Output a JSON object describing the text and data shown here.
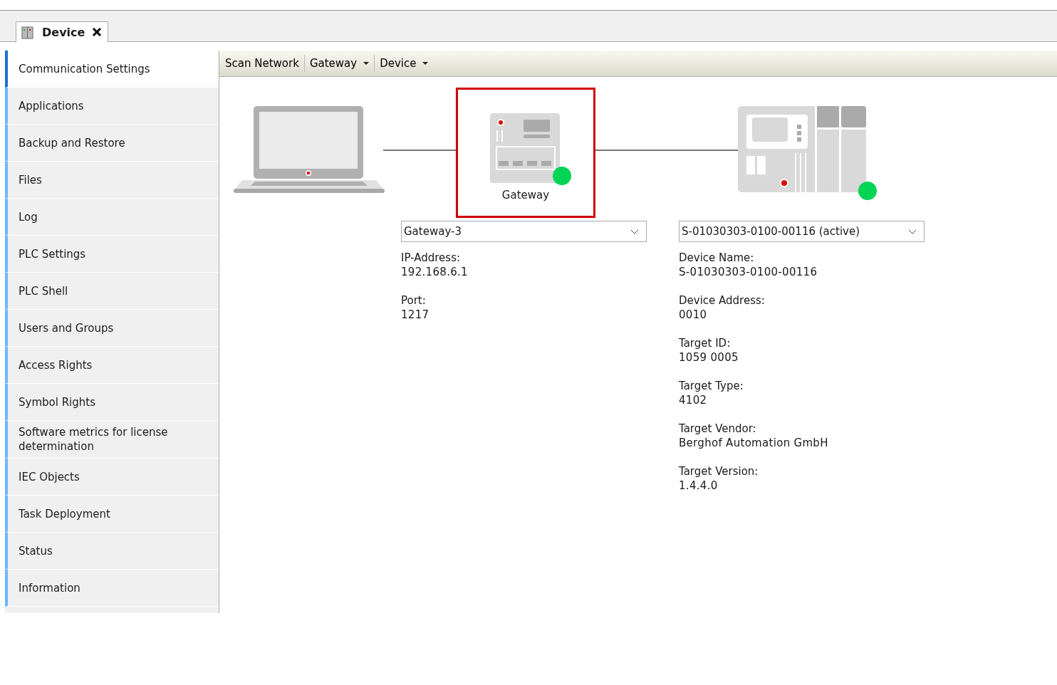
{
  "editor_tab": {
    "title": "Device",
    "selected": true
  },
  "sidebar": {
    "items": [
      {
        "label": "Communication Settings",
        "selected": true
      },
      {
        "label": "Applications",
        "selected": false
      },
      {
        "label": "Backup and Restore",
        "selected": false
      },
      {
        "label": "Files",
        "selected": false
      },
      {
        "label": "Log",
        "selected": false
      },
      {
        "label": "PLC Settings",
        "selected": false
      },
      {
        "label": "PLC Shell",
        "selected": false
      },
      {
        "label": "Users and Groups",
        "selected": false
      },
      {
        "label": "Access Rights",
        "selected": false
      },
      {
        "label": "Symbol Rights",
        "selected": false
      },
      {
        "label": "Software metrics for license determination",
        "selected": false
      },
      {
        "label": "IEC Objects",
        "selected": false
      },
      {
        "label": "Task Deployment",
        "selected": false
      },
      {
        "label": "Status",
        "selected": false
      },
      {
        "label": "Information",
        "selected": false
      }
    ]
  },
  "toolbar": [
    {
      "label": "Scan Network",
      "kind": "button"
    },
    {
      "label": "Gateway",
      "kind": "menu"
    },
    {
      "label": "Device",
      "kind": "menu"
    }
  ],
  "gateway": {
    "label": "Gateway",
    "highlighted": true,
    "color": "#00d455",
    "dropdown": "Gateway-3",
    "fields": [
      {
        "label": "IP-Address:",
        "value": "192.168.6.1"
      },
      {
        "label": "Port:",
        "value": "1217"
      }
    ]
  },
  "device": {
    "color": "#00d455",
    "dropdown": "S-01030303-0100-00116 (active)",
    "fields": [
      {
        "label": "Device Name:",
        "value": "S-01030303-0100-00116"
      },
      {
        "label": "Device Address:",
        "value": "0010"
      },
      {
        "label": "Target ID:",
        "value": "1059  0005"
      },
      {
        "label": "Target Type:",
        "value": "4102"
      },
      {
        "label": "Target Vendor:",
        "value": "Berghof Automation GmbH"
      },
      {
        "label": "Target Version:",
        "value": "1.4.4.0"
      }
    ]
  }
}
